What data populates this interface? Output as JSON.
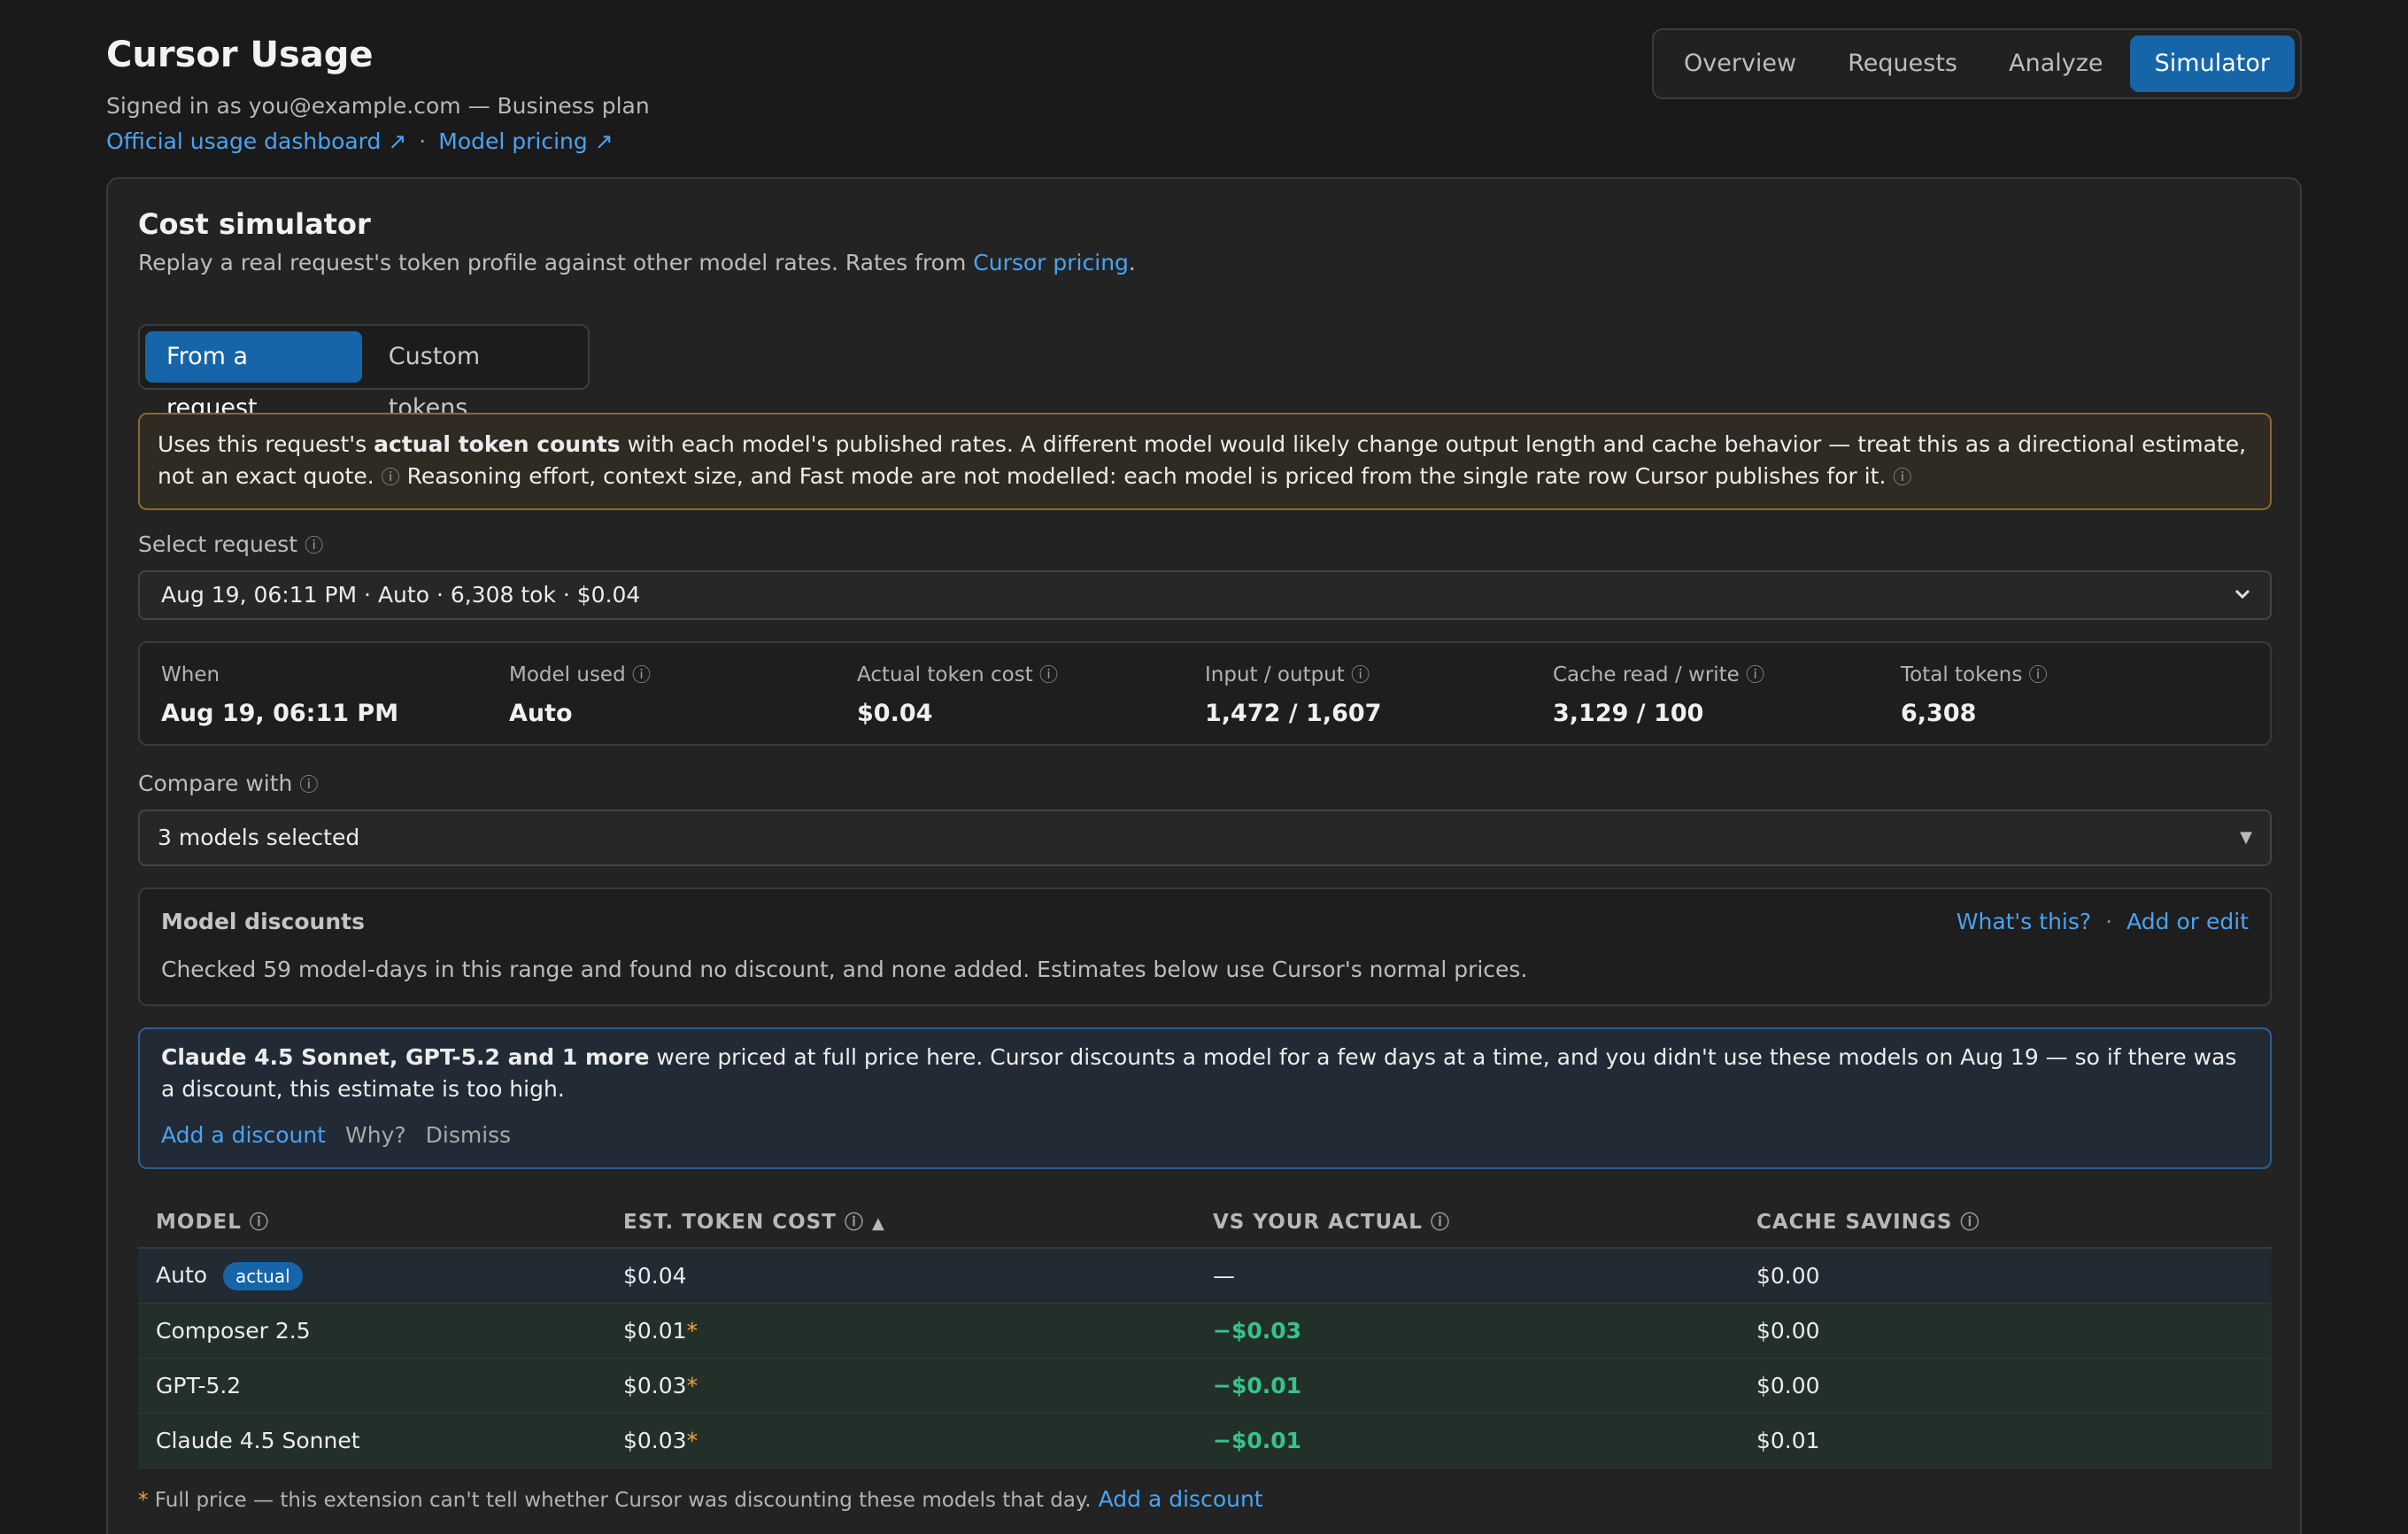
{
  "app": {
    "title": "Cursor Usage",
    "signed_in": "Signed in as you@example.com — Business plan",
    "link_dashboard": "Official usage dashboard ↗",
    "link_separator": "·",
    "link_pricing": "Model pricing ↗"
  },
  "tabs": [
    {
      "label": "Overview",
      "active": false
    },
    {
      "label": "Requests",
      "active": false
    },
    {
      "label": "Analyze",
      "active": false
    },
    {
      "label": "Simulator",
      "active": true
    }
  ],
  "simulator": {
    "title": "Cost simulator",
    "subtitle_prefix": "Replay a real request's token profile against other model rates. Rates from ",
    "subtitle_link": "Cursor pricing",
    "subtitle_suffix": ".",
    "mode_options": [
      "From a request",
      "Custom tokens"
    ],
    "warning": {
      "t1": "Uses this request's ",
      "bold": "actual token counts",
      "t2": " with each model's published rates. A different model would likely change output length and cache behavior — treat this as a directional estimate, not an exact quote. ",
      "t3": " Reasoning effort, context size, and Fast mode are not modelled: each model is priced from the single rate row Cursor publishes for it. "
    },
    "info_glyph": "ⓘ",
    "select_request_label": "Select request",
    "select_request_value": "Aug 19, 06:11 PM · Auto · 6,308 tok · $0.04",
    "stats": [
      {
        "label": "When",
        "value": "Aug 19, 06:11 PM",
        "info": false
      },
      {
        "label": "Model used",
        "value": "Auto",
        "info": true
      },
      {
        "label": "Actual token cost",
        "value": "$0.04",
        "info": true
      },
      {
        "label": "Input / output",
        "value": "1,472 / 1,607",
        "info": true
      },
      {
        "label": "Cache read / write",
        "value": "3,129 / 100",
        "info": true
      },
      {
        "label": "Total tokens",
        "value": "6,308",
        "info": true
      }
    ],
    "compare_label": "Compare with",
    "compare_value": "3 models selected",
    "discounts": {
      "title": "Model discounts",
      "whats_this": "What's this?",
      "sep": "·",
      "add_edit": "Add or edit",
      "text": "Checked 59 model-days in this range and found no discount, and none added. Estimates below use Cursor's normal prices."
    },
    "notice": {
      "bold": "Claude 4.5 Sonnet, GPT-5.2 and 1 more",
      "text": " were priced at full price here. Cursor discounts a model for a few days at a time, and you didn't use these models on Aug 19 — so if there was a discount, this estimate is too high.",
      "add_discount": "Add a discount",
      "why": "Why?",
      "dismiss": "Dismiss"
    },
    "table": {
      "headers": [
        "MODEL",
        "EST. TOKEN COST",
        "VS YOUR ACTUAL",
        "CACHE SAVINGS"
      ],
      "sort_glyph": "▲",
      "actual_badge": "actual",
      "rows": [
        {
          "model": "Auto",
          "actual": true,
          "cost": "$0.04",
          "star": "",
          "vs": "—",
          "cache": "$0.00"
        },
        {
          "model": "Composer 2.5",
          "actual": false,
          "cost": "$0.01",
          "star": "*",
          "vs": "−$0.03",
          "cache": "$0.00"
        },
        {
          "model": "GPT-5.2",
          "actual": false,
          "cost": "$0.03",
          "star": "*",
          "vs": "−$0.01",
          "cache": "$0.00"
        },
        {
          "model": "Claude 4.5 Sonnet",
          "actual": false,
          "cost": "$0.03",
          "star": "*",
          "vs": "−$0.01",
          "cache": "$0.01"
        }
      ]
    },
    "footnote": {
      "star": "*",
      "text": " Full price — this extension can't tell whether Cursor was discounting these models that day.",
      "link": "Add a discount"
    }
  }
}
